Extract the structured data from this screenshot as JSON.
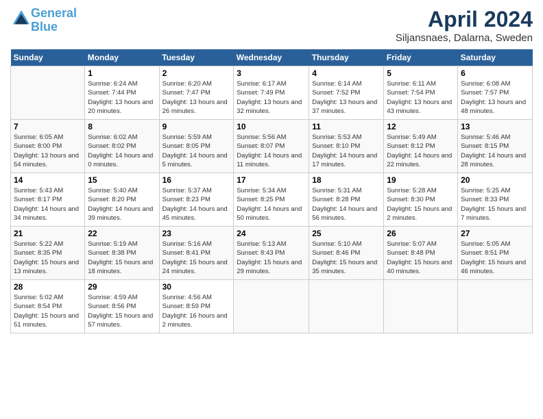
{
  "header": {
    "logo_line1": "General",
    "logo_line2": "Blue",
    "month_title": "April 2024",
    "subtitle": "Siljansnaes, Dalarna, Sweden"
  },
  "days_of_week": [
    "Sunday",
    "Monday",
    "Tuesday",
    "Wednesday",
    "Thursday",
    "Friday",
    "Saturday"
  ],
  "weeks": [
    [
      {
        "num": "",
        "sunrise": "",
        "sunset": "",
        "daylight": "",
        "empty": true
      },
      {
        "num": "1",
        "sunrise": "Sunrise: 6:24 AM",
        "sunset": "Sunset: 7:44 PM",
        "daylight": "Daylight: 13 hours and 20 minutes."
      },
      {
        "num": "2",
        "sunrise": "Sunrise: 6:20 AM",
        "sunset": "Sunset: 7:47 PM",
        "daylight": "Daylight: 13 hours and 26 minutes."
      },
      {
        "num": "3",
        "sunrise": "Sunrise: 6:17 AM",
        "sunset": "Sunset: 7:49 PM",
        "daylight": "Daylight: 13 hours and 32 minutes."
      },
      {
        "num": "4",
        "sunrise": "Sunrise: 6:14 AM",
        "sunset": "Sunset: 7:52 PM",
        "daylight": "Daylight: 13 hours and 37 minutes."
      },
      {
        "num": "5",
        "sunrise": "Sunrise: 6:11 AM",
        "sunset": "Sunset: 7:54 PM",
        "daylight": "Daylight: 13 hours and 43 minutes."
      },
      {
        "num": "6",
        "sunrise": "Sunrise: 6:08 AM",
        "sunset": "Sunset: 7:57 PM",
        "daylight": "Daylight: 13 hours and 48 minutes."
      }
    ],
    [
      {
        "num": "7",
        "sunrise": "Sunrise: 6:05 AM",
        "sunset": "Sunset: 8:00 PM",
        "daylight": "Daylight: 13 hours and 54 minutes."
      },
      {
        "num": "8",
        "sunrise": "Sunrise: 6:02 AM",
        "sunset": "Sunset: 8:02 PM",
        "daylight": "Daylight: 14 hours and 0 minutes."
      },
      {
        "num": "9",
        "sunrise": "Sunrise: 5:59 AM",
        "sunset": "Sunset: 8:05 PM",
        "daylight": "Daylight: 14 hours and 5 minutes."
      },
      {
        "num": "10",
        "sunrise": "Sunrise: 5:56 AM",
        "sunset": "Sunset: 8:07 PM",
        "daylight": "Daylight: 14 hours and 11 minutes."
      },
      {
        "num": "11",
        "sunrise": "Sunrise: 5:53 AM",
        "sunset": "Sunset: 8:10 PM",
        "daylight": "Daylight: 14 hours and 17 minutes."
      },
      {
        "num": "12",
        "sunrise": "Sunrise: 5:49 AM",
        "sunset": "Sunset: 8:12 PM",
        "daylight": "Daylight: 14 hours and 22 minutes."
      },
      {
        "num": "13",
        "sunrise": "Sunrise: 5:46 AM",
        "sunset": "Sunset: 8:15 PM",
        "daylight": "Daylight: 14 hours and 28 minutes."
      }
    ],
    [
      {
        "num": "14",
        "sunrise": "Sunrise: 5:43 AM",
        "sunset": "Sunset: 8:17 PM",
        "daylight": "Daylight: 14 hours and 34 minutes."
      },
      {
        "num": "15",
        "sunrise": "Sunrise: 5:40 AM",
        "sunset": "Sunset: 8:20 PM",
        "daylight": "Daylight: 14 hours and 39 minutes."
      },
      {
        "num": "16",
        "sunrise": "Sunrise: 5:37 AM",
        "sunset": "Sunset: 8:23 PM",
        "daylight": "Daylight: 14 hours and 45 minutes."
      },
      {
        "num": "17",
        "sunrise": "Sunrise: 5:34 AM",
        "sunset": "Sunset: 8:25 PM",
        "daylight": "Daylight: 14 hours and 50 minutes."
      },
      {
        "num": "18",
        "sunrise": "Sunrise: 5:31 AM",
        "sunset": "Sunset: 8:28 PM",
        "daylight": "Daylight: 14 hours and 56 minutes."
      },
      {
        "num": "19",
        "sunrise": "Sunrise: 5:28 AM",
        "sunset": "Sunset: 8:30 PM",
        "daylight": "Daylight: 15 hours and 2 minutes."
      },
      {
        "num": "20",
        "sunrise": "Sunrise: 5:25 AM",
        "sunset": "Sunset: 8:33 PM",
        "daylight": "Daylight: 15 hours and 7 minutes."
      }
    ],
    [
      {
        "num": "21",
        "sunrise": "Sunrise: 5:22 AM",
        "sunset": "Sunset: 8:35 PM",
        "daylight": "Daylight: 15 hours and 13 minutes."
      },
      {
        "num": "22",
        "sunrise": "Sunrise: 5:19 AM",
        "sunset": "Sunset: 8:38 PM",
        "daylight": "Daylight: 15 hours and 18 minutes."
      },
      {
        "num": "23",
        "sunrise": "Sunrise: 5:16 AM",
        "sunset": "Sunset: 8:41 PM",
        "daylight": "Daylight: 15 hours and 24 minutes."
      },
      {
        "num": "24",
        "sunrise": "Sunrise: 5:13 AM",
        "sunset": "Sunset: 8:43 PM",
        "daylight": "Daylight: 15 hours and 29 minutes."
      },
      {
        "num": "25",
        "sunrise": "Sunrise: 5:10 AM",
        "sunset": "Sunset: 8:46 PM",
        "daylight": "Daylight: 15 hours and 35 minutes."
      },
      {
        "num": "26",
        "sunrise": "Sunrise: 5:07 AM",
        "sunset": "Sunset: 8:48 PM",
        "daylight": "Daylight: 15 hours and 40 minutes."
      },
      {
        "num": "27",
        "sunrise": "Sunrise: 5:05 AM",
        "sunset": "Sunset: 8:51 PM",
        "daylight": "Daylight: 15 hours and 46 minutes."
      }
    ],
    [
      {
        "num": "28",
        "sunrise": "Sunrise: 5:02 AM",
        "sunset": "Sunset: 8:54 PM",
        "daylight": "Daylight: 15 hours and 51 minutes."
      },
      {
        "num": "29",
        "sunrise": "Sunrise: 4:59 AM",
        "sunset": "Sunset: 8:56 PM",
        "daylight": "Daylight: 15 hours and 57 minutes."
      },
      {
        "num": "30",
        "sunrise": "Sunrise: 4:56 AM",
        "sunset": "Sunset: 8:59 PM",
        "daylight": "Daylight: 16 hours and 2 minutes."
      },
      {
        "num": "",
        "sunrise": "",
        "sunset": "",
        "daylight": "",
        "empty": true
      },
      {
        "num": "",
        "sunrise": "",
        "sunset": "",
        "daylight": "",
        "empty": true
      },
      {
        "num": "",
        "sunrise": "",
        "sunset": "",
        "daylight": "",
        "empty": true
      },
      {
        "num": "",
        "sunrise": "",
        "sunset": "",
        "daylight": "",
        "empty": true
      }
    ]
  ]
}
